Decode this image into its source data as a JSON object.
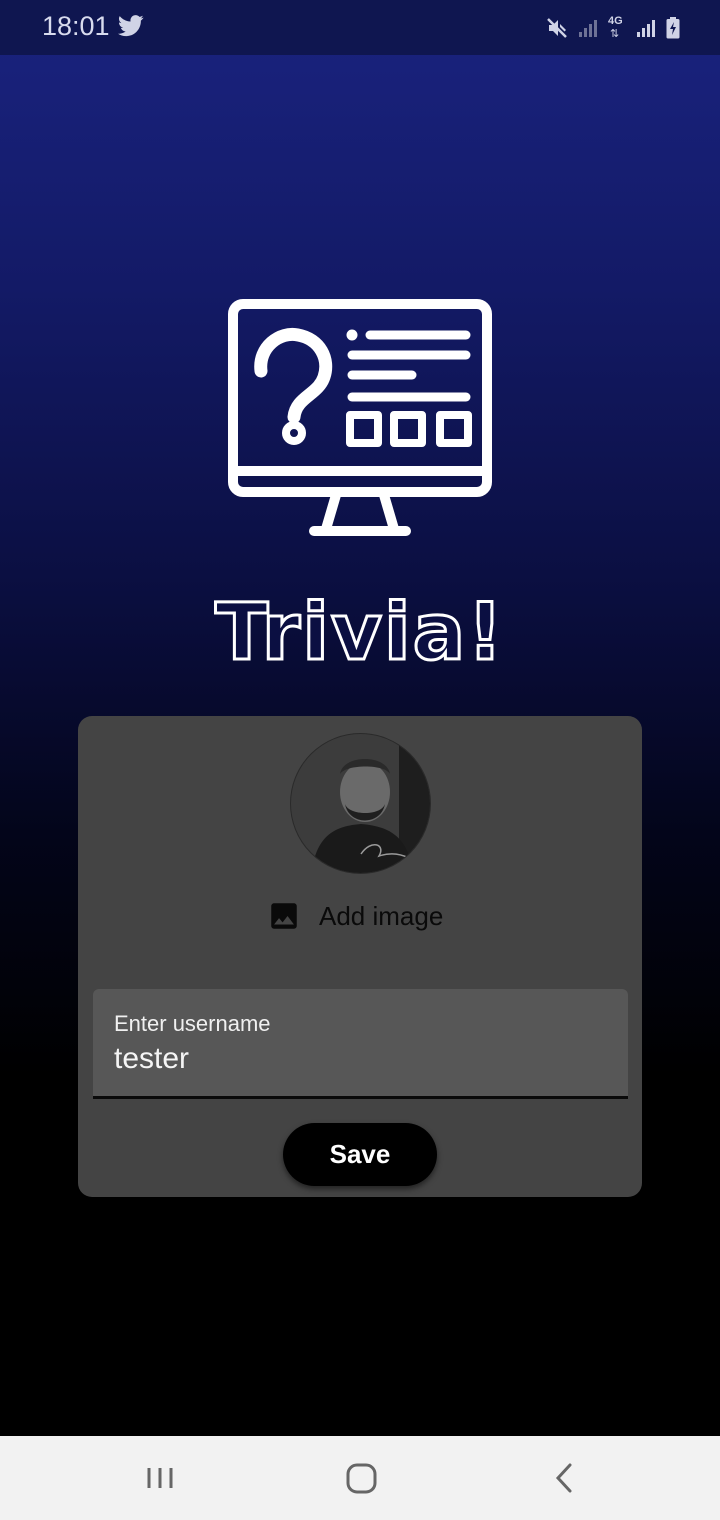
{
  "status_bar": {
    "time": "18:01",
    "left_icons": [
      "twitter-icon"
    ],
    "right_icons": [
      "mute-icon",
      "signal-weak-icon",
      "network-4g-icon",
      "signal-icon",
      "battery-charging-icon"
    ],
    "network_label": "4G"
  },
  "app": {
    "logo_icon": "trivia-monitor-icon",
    "title": "Trivia!"
  },
  "profile_card": {
    "avatar": "profile-photo",
    "add_image_icon": "image-icon",
    "add_image_label": "Add image",
    "username_label": "Enter username",
    "username_value": "tester",
    "save_label": "Save"
  },
  "nav_bar": {
    "items": [
      "recent-apps-icon",
      "home-icon",
      "back-icon"
    ]
  },
  "colors": {
    "gradient_top": "#1a2380",
    "background_bottom": "#000000",
    "card": "#444444",
    "field": "#575757",
    "button": "#000000",
    "nav_bar": "#f2f2f2"
  }
}
